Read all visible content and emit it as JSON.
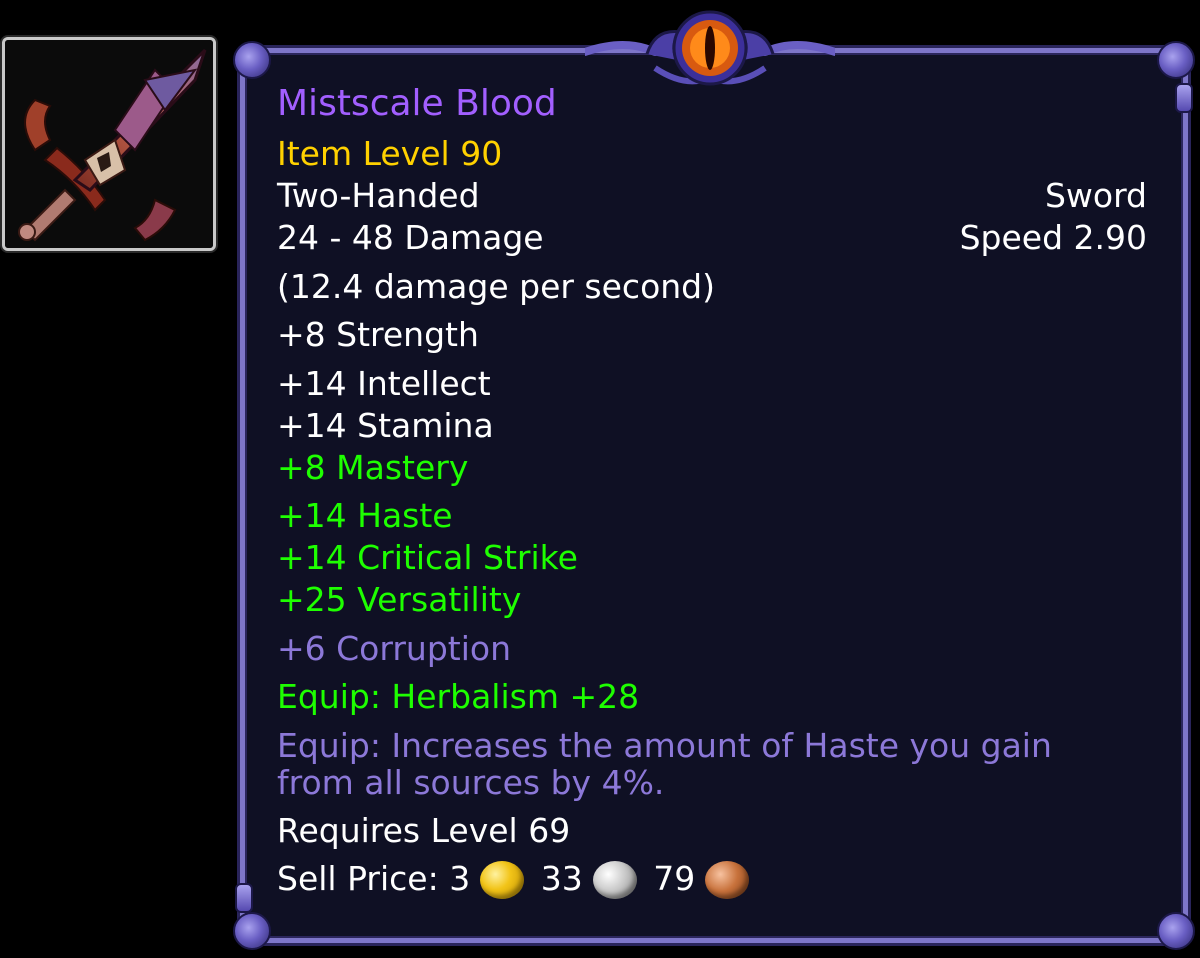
{
  "icon": {
    "name": "two-handed-sword-icon"
  },
  "tooltip": {
    "name": "Mistscale Blood",
    "item_level": "Item Level 90",
    "slot": "Two-Handed",
    "type": "Sword",
    "damage": "24 - 48 Damage",
    "speed": "Speed 2.90",
    "dps": "(12.4 damage per second)",
    "stats_primary": [
      "+8 Strength",
      "+14 Intellect",
      "+14 Stamina"
    ],
    "stats_secondary": [
      "+8 Mastery",
      "+14 Haste",
      "+14 Critical Strike",
      "+25 Versatility"
    ],
    "corruption": "+6 Corruption",
    "equip_profession": "Equip: Herbalism +28",
    "equip_effect": "Equip: Increases the amount of Haste you gain from all sources by 4%.",
    "requires": "Requires Level 69",
    "sell_price": {
      "label": "Sell Price:",
      "gold": "3",
      "silver": "33",
      "copper": "79"
    }
  },
  "colors": {
    "name": "#a25fff",
    "item_level": "#ffd100",
    "green": "#1eff00",
    "corruption": "#8c78d8",
    "border": "#7e76c9",
    "background": "#0f1024"
  }
}
